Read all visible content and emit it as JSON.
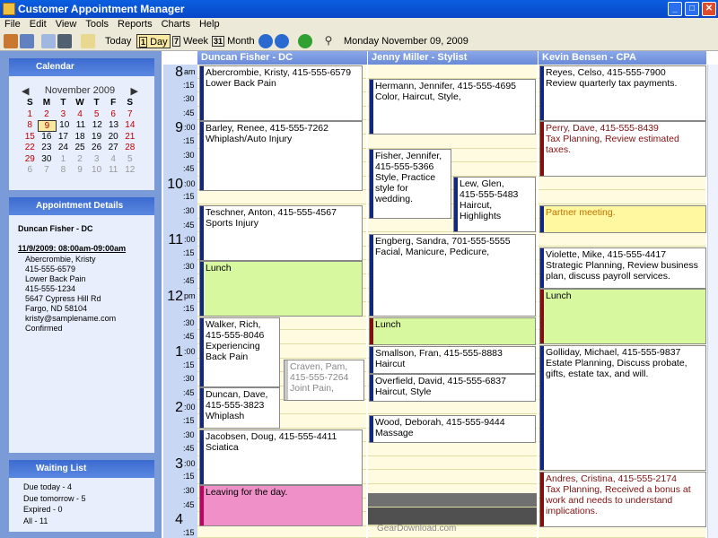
{
  "title": "Customer Appointment Manager",
  "menu": [
    "File",
    "Edit",
    "View",
    "Tools",
    "Reports",
    "Charts",
    "Help"
  ],
  "toolbar": {
    "today": "Today",
    "day": "Day",
    "week": "Week",
    "month": "Month",
    "date": "Monday November 09, 2009"
  },
  "calendar": {
    "header": "Calendar",
    "month": "November 2009",
    "dow": [
      "S",
      "M",
      "T",
      "W",
      "T",
      "F",
      "S"
    ],
    "rows": [
      [
        "1",
        "2",
        "3",
        "4",
        "5",
        "6",
        "7"
      ],
      [
        "8",
        "9",
        "10",
        "11",
        "12",
        "13",
        "14"
      ],
      [
        "15",
        "16",
        "17",
        "18",
        "19",
        "20",
        "21"
      ],
      [
        "22",
        "23",
        "24",
        "25",
        "26",
        "27",
        "28"
      ],
      [
        "29",
        "30",
        "1",
        "2",
        "3",
        "4",
        "5"
      ],
      [
        "6",
        "7",
        "8",
        "9",
        "10",
        "11",
        "12"
      ]
    ]
  },
  "details": {
    "header": "Appointment Details",
    "name": "Duncan Fisher - DC",
    "time": "11/9/2009: 08:00am-09:00am",
    "lines": [
      "Abercrombie, Kristy",
      "415-555-6579",
      "Lower Back Pain",
      "415-555-1234",
      "5647 Cypress Hill Rd",
      "Fargo, ND 58104",
      "kristy@samplename.com",
      "Confirmed"
    ]
  },
  "waiting": {
    "header": "Waiting List",
    "lines": [
      "Due today - 4",
      "Due tomorrow - 5",
      "Expired - 0",
      "All - 11"
    ]
  },
  "columns": [
    "Duncan Fisher - DC",
    "Jenny Miller - Stylist",
    "Kevin Bensen - CPA"
  ],
  "hours": [
    [
      "8",
      "am"
    ],
    [
      "9",
      ":00"
    ],
    [
      "10",
      ":00"
    ],
    [
      "11",
      ":00"
    ],
    [
      "12",
      "pm"
    ],
    [
      "1",
      ":00"
    ],
    [
      "2",
      ":00"
    ],
    [
      "3",
      ":00"
    ],
    [
      "4",
      ""
    ]
  ],
  "minutes": [
    ":15",
    ":30",
    ":45"
  ],
  "appointments": [
    {
      "col": 0,
      "t": "Abercrombie, Kristy, 415-555-6579\nLower Back Pain"
    },
    {
      "col": 0,
      "t": "Barley, Renee, 415-555-7262\nWhiplash/Auto Injury"
    },
    {
      "col": 0,
      "t": "Teschner, Anton, 415-555-4567\nSports Injury"
    },
    {
      "col": 0,
      "t": "Lunch"
    },
    {
      "col": 0,
      "t": "Walker, Rich,\n415-555-8046\nExperiencing\nBack Pain"
    },
    {
      "col": 0,
      "t": "Craven, Pam,\n415-555-7264\nJoint Pain,"
    },
    {
      "col": 0,
      "t": "Duncan, Dave,\n415-555-3823\nWhiplash"
    },
    {
      "col": 0,
      "t": "Jacobsen, Doug, 415-555-4411\nSciatica"
    },
    {
      "col": 0,
      "t": "Leaving for the day."
    },
    {
      "col": 1,
      "t": "Hermann, Jennifer, 415-555-4695\nColor, Haircut, Style,"
    },
    {
      "col": 1,
      "t": "Fisher, Jennifer,\n415-555-5366\nStyle, Practice\nstyle for wedding."
    },
    {
      "col": 1,
      "t": "Lew, Glen,\n415-555-5483\nHaircut,\nHighlights"
    },
    {
      "col": 1,
      "t": "Engberg, Sandra, 701-555-5555\nFacial, Manicure, Pedicure,"
    },
    {
      "col": 1,
      "t": "Lunch"
    },
    {
      "col": 1,
      "t": "Smallson, Fran, 415-555-8883\nHaircut"
    },
    {
      "col": 1,
      "t": "Overfield, David, 415-555-6837\nHaircut, Style"
    },
    {
      "col": 1,
      "t": "Wood, Deborah, 415-555-9444\nMassage"
    },
    {
      "col": 2,
      "t": "Reyes, Celso, 415-555-7900\nReview quarterly tax payments."
    },
    {
      "col": 2,
      "t": "Perry, Dave, 415-555-8439\nTax Planning, Review estimated taxes."
    },
    {
      "col": 2,
      "t": "Partner meeting."
    },
    {
      "col": 2,
      "t": "Violette, Mike, 415-555-4417\nStrategic Planning, Review business\nplan, discuss payroll services."
    },
    {
      "col": 2,
      "t": "Lunch"
    },
    {
      "col": 2,
      "t": "Golliday, Michael, 415-555-9837\nEstate Planning, Discuss probate,\ngifts, estate tax, and will."
    },
    {
      "col": 2,
      "t": "Andres, Cristina, 415-555-2174\nTax Planning, Received a bonus at\nwork and needs to understand\nimplications."
    }
  ],
  "watermark": "GearDownload.com"
}
